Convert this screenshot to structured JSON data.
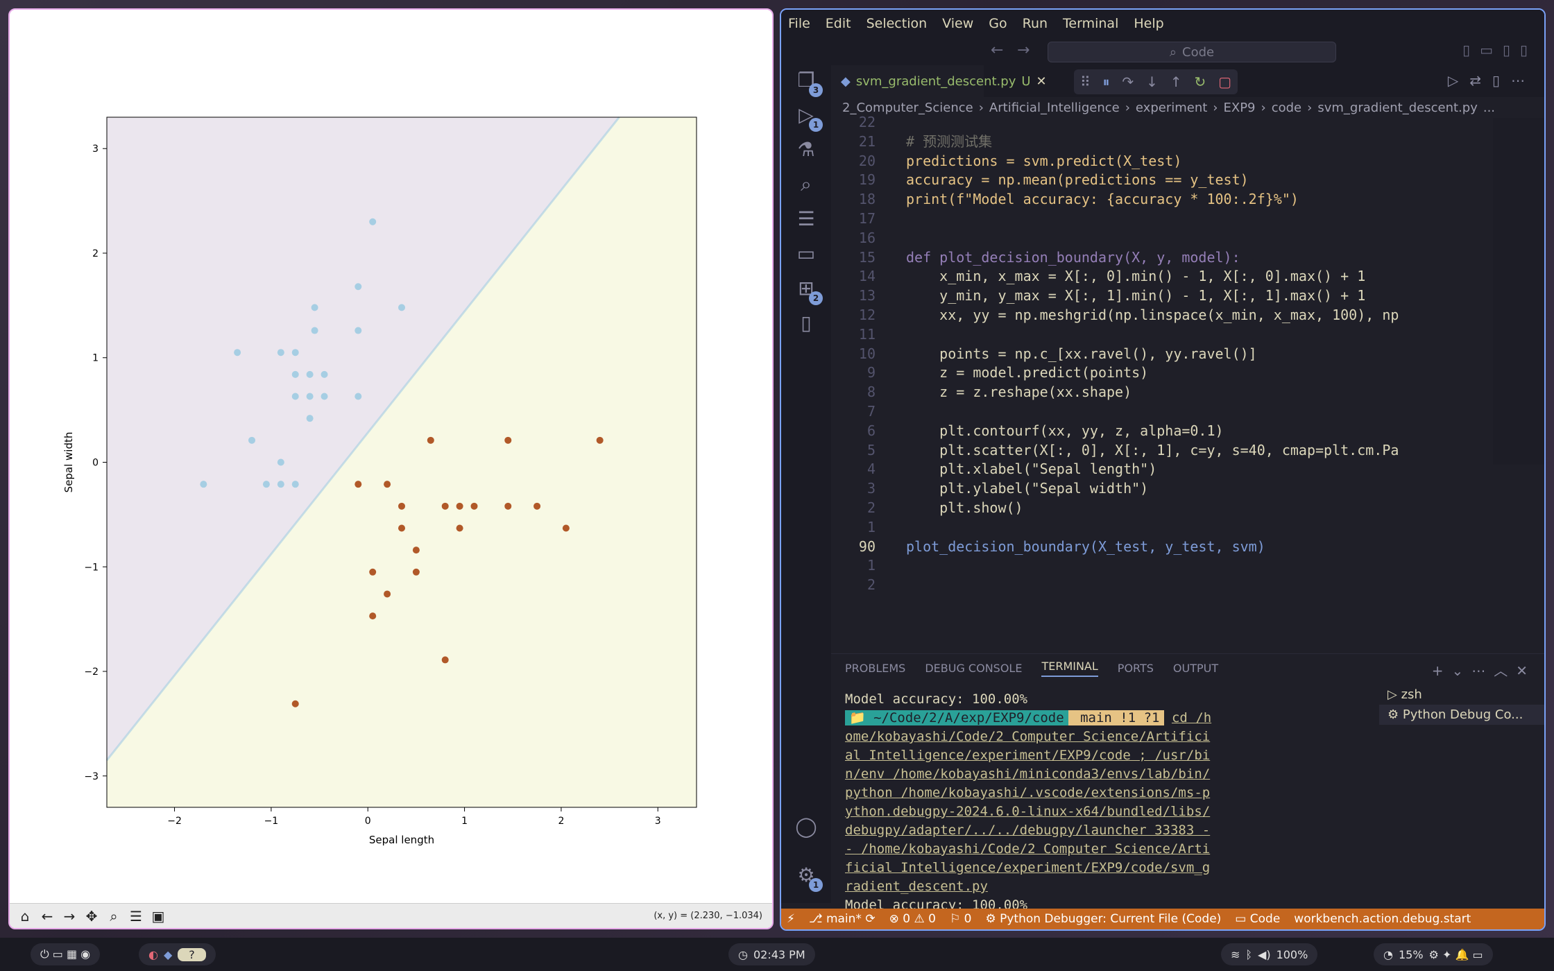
{
  "plot_window": {
    "coord_readout": "(x, y) = (2.230, −1.034)",
    "toolbar": [
      "home-icon",
      "back-icon",
      "forward-icon",
      "pan-icon",
      "zoom-icon",
      "configure-icon",
      "save-icon"
    ]
  },
  "chart_data": {
    "type": "scatter",
    "xlabel": "Sepal length",
    "ylabel": "Sepal width",
    "xlim": [
      -2.7,
      3.4
    ],
    "ylim": [
      -3.3,
      3.3
    ],
    "xticks": [
      "−2",
      "−1",
      "0",
      "1",
      "2",
      "3"
    ],
    "yticks": [
      "−3",
      "−2",
      "−1",
      "0",
      "1",
      "2",
      "3"
    ],
    "decision_boundary": {
      "class0_region": "top-left",
      "color0": "#ebe6ee",
      "color1": "#f8f9e4",
      "line": [
        [
          -2.7,
          -2.85
        ],
        [
          2.6,
          3.3
        ]
      ]
    },
    "series": [
      {
        "color": "#a6cee3",
        "points": [
          [
            0.05,
            2.3
          ],
          [
            -0.1,
            1.68
          ],
          [
            -0.55,
            1.48
          ],
          [
            0.35,
            1.48
          ],
          [
            -0.55,
            1.26
          ],
          [
            -0.1,
            1.26
          ],
          [
            -1.35,
            1.05
          ],
          [
            -0.9,
            1.05
          ],
          [
            -0.75,
            1.05
          ],
          [
            -0.75,
            0.84
          ],
          [
            -0.6,
            0.84
          ],
          [
            -0.45,
            0.84
          ],
          [
            -0.75,
            0.63
          ],
          [
            -0.6,
            0.63
          ],
          [
            -0.45,
            0.63
          ],
          [
            -0.1,
            0.63
          ],
          [
            -0.6,
            0.42
          ],
          [
            -1.2,
            0.21
          ],
          [
            -0.9,
            0.0
          ],
          [
            -1.7,
            -0.21
          ],
          [
            -1.05,
            -0.21
          ],
          [
            -0.9,
            -0.21
          ],
          [
            -0.75,
            -0.21
          ]
        ]
      },
      {
        "color": "#b15928",
        "points": [
          [
            0.65,
            0.21
          ],
          [
            1.45,
            0.21
          ],
          [
            2.4,
            0.21
          ],
          [
            -0.1,
            -0.21
          ],
          [
            0.2,
            -0.21
          ],
          [
            0.35,
            -0.42
          ],
          [
            0.8,
            -0.42
          ],
          [
            0.95,
            -0.42
          ],
          [
            1.1,
            -0.42
          ],
          [
            1.45,
            -0.42
          ],
          [
            1.75,
            -0.42
          ],
          [
            0.35,
            -0.63
          ],
          [
            0.95,
            -0.63
          ],
          [
            2.05,
            -0.63
          ],
          [
            0.5,
            -0.84
          ],
          [
            0.05,
            -1.05
          ],
          [
            0.5,
            -1.05
          ],
          [
            0.2,
            -1.26
          ],
          [
            0.05,
            -1.47
          ],
          [
            0.8,
            -1.89
          ],
          [
            -0.75,
            -2.31
          ]
        ]
      }
    ]
  },
  "vscode": {
    "menu": [
      "File",
      "Edit",
      "Selection",
      "View",
      "Go",
      "Run",
      "Terminal",
      "Help"
    ],
    "command_center": "Code",
    "tab_name": "svm_gradient_descent.py",
    "tab_status": "U",
    "breadcrumb": [
      "2_Computer_Science",
      "Artificial_Intelligence",
      "experiment",
      "EXP9",
      "code",
      "svm_gradient_descent.py",
      "..."
    ],
    "badges": {
      "explorer": "3",
      "debug": "1",
      "extensions": "2",
      "settings": "1"
    },
    "code_lines": [
      {
        "n": "22",
        "t": ""
      },
      {
        "n": "21",
        "t": "# 预测测试集"
      },
      {
        "n": "20",
        "t": "predictions = svm.predict(X_test)"
      },
      {
        "n": "19",
        "t": "accuracy = np.mean(predictions == y_test)"
      },
      {
        "n": "18",
        "t": "print(f\"Model accuracy: {accuracy * 100:.2f}%\")"
      },
      {
        "n": "17",
        "t": ""
      },
      {
        "n": "16",
        "t": ""
      },
      {
        "n": "15",
        "t": "def plot_decision_boundary(X, y, model):"
      },
      {
        "n": "14",
        "t": "    x_min, x_max = X[:, 0].min() - 1, X[:, 0].max() + 1"
      },
      {
        "n": "13",
        "t": "    y_min, y_max = X[:, 1].min() - 1, X[:, 1].max() + 1"
      },
      {
        "n": "12",
        "t": "    xx, yy = np.meshgrid(np.linspace(x_min, x_max, 100), np"
      },
      {
        "n": "11",
        "t": ""
      },
      {
        "n": "10",
        "t": "    points = np.c_[xx.ravel(), yy.ravel()]"
      },
      {
        "n": "9",
        "t": "    z = model.predict(points)"
      },
      {
        "n": "8",
        "t": "    z = z.reshape(xx.shape)"
      },
      {
        "n": "7",
        "t": ""
      },
      {
        "n": "6",
        "t": "    plt.contourf(xx, yy, z, alpha=0.1)"
      },
      {
        "n": "5",
        "t": "    plt.scatter(X[:, 0], X[:, 1], c=y, s=40, cmap=plt.cm.Pa"
      },
      {
        "n": "4",
        "t": "    plt.xlabel(\"Sepal length\")"
      },
      {
        "n": "3",
        "t": "    plt.ylabel(\"Sepal width\")"
      },
      {
        "n": "2",
        "t": "    plt.show()"
      },
      {
        "n": "1",
        "t": ""
      },
      {
        "n": "90",
        "t": "plot_decision_boundary(X_test, y_test, svm)"
      },
      {
        "n": "1",
        "t": ""
      },
      {
        "n": "2",
        "t": ""
      }
    ],
    "panel_tabs": [
      "PROBLEMS",
      "DEBUG CONSOLE",
      "TERMINAL",
      "PORTS",
      "OUTPUT"
    ],
    "terminal": {
      "line1": "Model accuracy: 100.00%",
      "prompt_dir": "~/Code/2/A/exp/EXP9/code",
      "prompt_git": "main !1 ?1",
      "cmd": "cd /home/kobayashi/Code/2 Computer Science/Artificial Intelligence/experiment/EXP9/code ; /usr/bin/env /home/kobayashi/miniconda3/envs/lab/bin/python /home/kobayashi/.vscode/extensions/ms-python.debugpy-2024.6.0-linux-x64/bundled/libs/debugpy/adapter/../../debugpy/launcher 33383 -- /home/kobayashi/Code/2 Computer Science/Artificial Intelligence/experiment/EXP9/code/svm_gradient_descent.py",
      "line_last": "Model accuracy: 100.00%"
    },
    "terminals": [
      "zsh",
      "Python Debug Co..."
    ],
    "status": {
      "branch": "main*",
      "errors": "0",
      "warnings": "0",
      "ports": "0",
      "debugger": "Python Debugger: Current File (Code)",
      "folder": "Code",
      "action": "workbench.action.debug.start"
    }
  },
  "taskbar": {
    "clock": "02:43 PM",
    "volume": "100%",
    "battery": "15%"
  }
}
